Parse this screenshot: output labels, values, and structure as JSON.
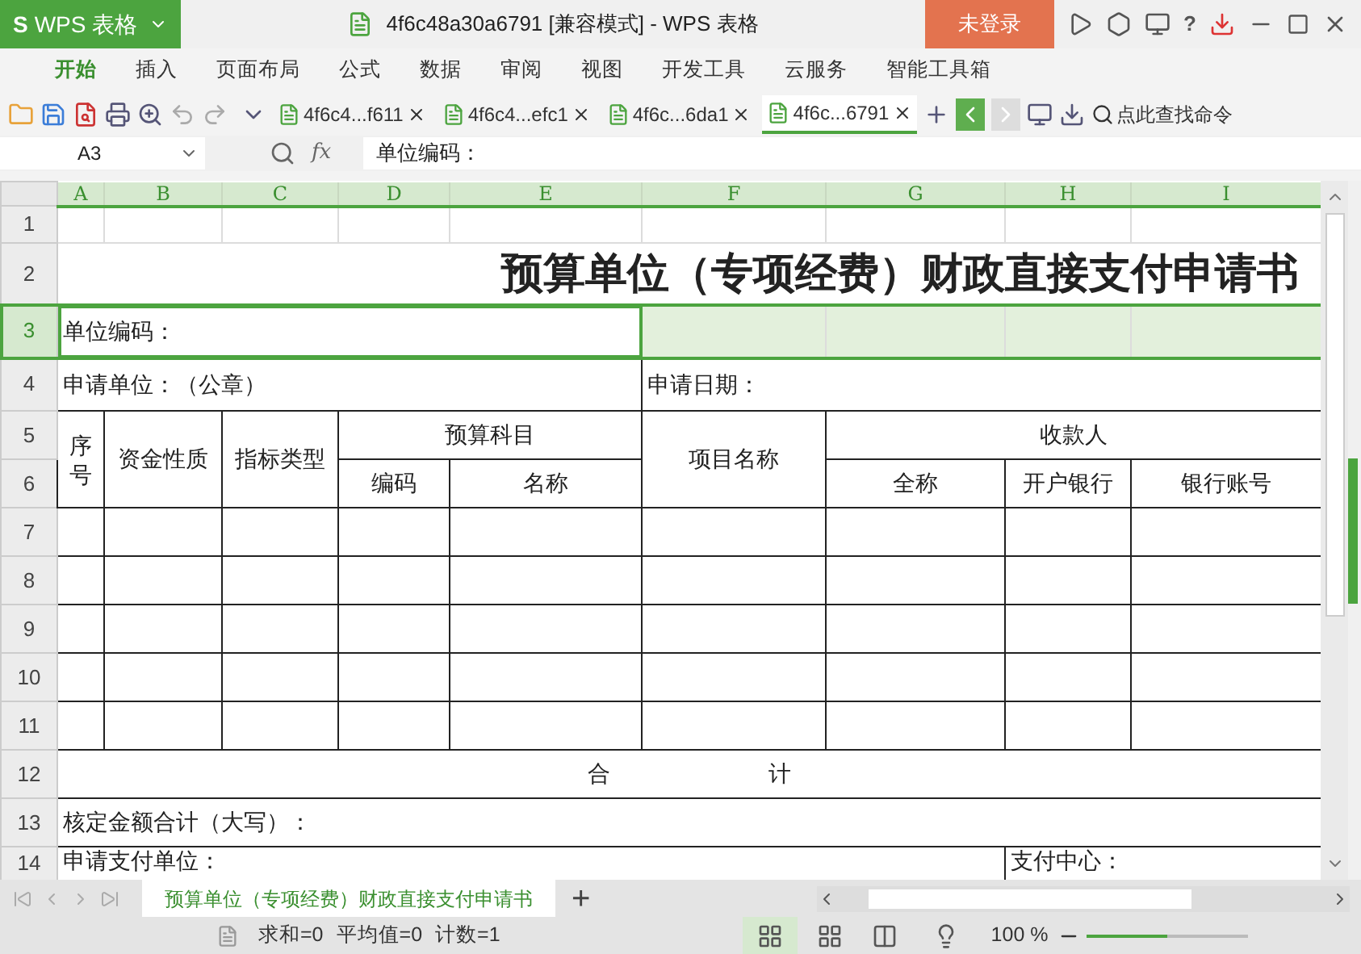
{
  "app_button": {
    "logo": "S",
    "label": "WPS 表格"
  },
  "window": {
    "title": "4f6c48a30a6791 [兼容模式] - WPS 表格"
  },
  "login_button": {
    "label": "未登录"
  },
  "help_button": {
    "label": "?"
  },
  "menu": [
    {
      "label": "开始",
      "selected": true
    },
    {
      "label": "插入",
      "selected": false
    },
    {
      "label": "页面布局",
      "selected": false
    },
    {
      "label": "公式",
      "selected": false
    },
    {
      "label": "数据",
      "selected": false
    },
    {
      "label": "审阅",
      "selected": false
    },
    {
      "label": "视图",
      "selected": false
    },
    {
      "label": "开发工具",
      "selected": false
    },
    {
      "label": "云服务",
      "selected": false
    },
    {
      "label": "智能工具箱",
      "selected": false
    }
  ],
  "doc_tabs": [
    {
      "label": "4f6c4...f611",
      "selected": false
    },
    {
      "label": "4f6c4...efc1",
      "selected": false
    },
    {
      "label": "4f6c...6da1",
      "selected": false
    },
    {
      "label": "4f6c...6791",
      "selected": true
    }
  ],
  "command_search": {
    "placeholder": "点此查找命令"
  },
  "name_box": {
    "value": "A3"
  },
  "formula_bar": {
    "fx": "fx",
    "value": "单位编码："
  },
  "columns": [
    {
      "label": "A",
      "selected": true
    },
    {
      "label": "B",
      "selected": true
    },
    {
      "label": "C",
      "selected": true
    },
    {
      "label": "D",
      "selected": true
    },
    {
      "label": "E",
      "selected": true
    },
    {
      "label": "F",
      "selected": true
    },
    {
      "label": "G",
      "selected": true
    },
    {
      "label": "H",
      "selected": true
    },
    {
      "label": "I",
      "selected": true
    }
  ],
  "rows": [
    {
      "label": "1",
      "selected": false,
      "ruled": false,
      "cells": [
        {},
        {},
        {},
        {},
        {},
        {},
        {},
        {},
        {}
      ]
    },
    {
      "label": "2",
      "selected": false,
      "ruled": false,
      "cells": [
        {
          "text": "预算单位（专项经费）财政直接支付申请书",
          "kind": "title"
        }
      ]
    },
    {
      "label": "3",
      "selected": true,
      "ruled": false,
      "cells": [
        {
          "text": "单位编码：",
          "active": true
        },
        {
          "active": false
        },
        {
          "active": false
        },
        {
          "active": false
        },
        {
          "active": false
        }
      ]
    },
    {
      "label": "4",
      "selected": false,
      "ruled": true,
      "cells": [
        {
          "text": "申请单位：（公章）"
        },
        {
          "text": "申请日期："
        }
      ]
    },
    {
      "label": "5",
      "selected": false,
      "ruled": true,
      "cells": [
        {
          "text": "序号",
          "kind": "narrow"
        },
        {
          "text": "资金性质",
          "kind": "center"
        },
        {
          "text": "指标类型",
          "kind": "center"
        },
        {
          "text": "预算科目",
          "kind": "center"
        },
        {
          "text": "项目名称",
          "kind": "center"
        },
        {
          "text": "收款人",
          "kind": "center"
        }
      ]
    },
    {
      "label": "6",
      "selected": false,
      "ruled": true,
      "cells": [
        {
          "text": "编码",
          "kind": "center"
        },
        {
          "text": "名称",
          "kind": "center"
        },
        {
          "text": "全称",
          "kind": "center"
        },
        {
          "text": "开户银行",
          "kind": "center"
        },
        {
          "text": "银行账号",
          "kind": "center"
        }
      ]
    },
    {
      "label": "7",
      "selected": false,
      "ruled": true,
      "cells": [
        {},
        {},
        {},
        {},
        {},
        {},
        {},
        {},
        {}
      ]
    },
    {
      "label": "8",
      "selected": false,
      "ruled": true,
      "cells": [
        {},
        {},
        {},
        {},
        {},
        {},
        {},
        {},
        {}
      ]
    },
    {
      "label": "9",
      "selected": false,
      "ruled": true,
      "cells": [
        {},
        {},
        {},
        {},
        {},
        {},
        {},
        {},
        {}
      ]
    },
    {
      "label": "10",
      "selected": false,
      "ruled": true,
      "cells": [
        {},
        {},
        {},
        {},
        {},
        {},
        {},
        {},
        {}
      ]
    },
    {
      "label": "11",
      "selected": false,
      "ruled": true,
      "cells": [
        {},
        {},
        {},
        {},
        {},
        {},
        {},
        {},
        {}
      ]
    },
    {
      "label": "12",
      "selected": false,
      "ruled": true,
      "cells": [
        {
          "text": "合　　　　　　　计",
          "kind": "center"
        }
      ]
    },
    {
      "label": "13",
      "selected": false,
      "ruled": true,
      "cells": [
        {
          "text": "核定金额合计（大写）："
        }
      ]
    },
    {
      "label": "14",
      "selected": false,
      "ruled": true,
      "cells": [
        {
          "text": "申请支付单位："
        },
        {
          "text": "支付中心："
        }
      ]
    }
  ],
  "sheet_tabs": [
    {
      "label": "预算单位（专项经费）财政直接支付申请书",
      "selected": true
    }
  ],
  "add_sheet": {
    "label": "+"
  },
  "status_bar": {
    "sum": "求和=0",
    "average": "平均值=0",
    "count": "计数=1",
    "zoom": "100 %"
  },
  "zoom_slider": {
    "level": 0.5
  }
}
